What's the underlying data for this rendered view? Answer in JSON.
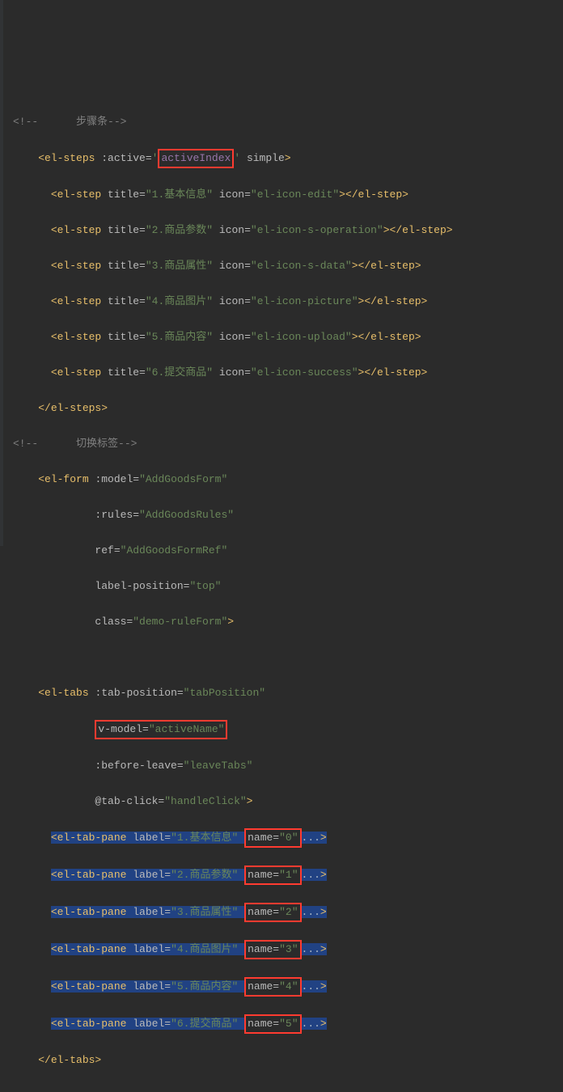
{
  "comment_steps": "步骤条",
  "comment_tabs": "切换标签",
  "steps": {
    "open": "<el-steps",
    "active_attr": ":active=",
    "active_q1": "'",
    "active_q2": "'",
    "active_val": "activeIndex",
    "simple": "simple",
    "close": "</el-steps>",
    "items": [
      {
        "title": "\"1.基本信息\"",
        "icon": "\"el-icon-edit\""
      },
      {
        "title": "\"2.商品参数\"",
        "icon": "\"el-icon-s-operation\""
      },
      {
        "title": "\"3.商品属性\"",
        "icon": "\"el-icon-s-data\""
      },
      {
        "title": "\"4.商品图片\"",
        "icon": "\"el-icon-picture\""
      },
      {
        "title": "\"5.商品内容\"",
        "icon": "\"el-icon-upload\""
      },
      {
        "title": "\"6.提交商品\"",
        "icon": "\"el-icon-success\""
      }
    ],
    "step_open": "<el-step",
    "step_close": "</el-step>",
    "title_attr": "title=",
    "icon_attr": "icon="
  },
  "form": {
    "open": "<el-form",
    "model_attr": ":model=",
    "model_val": "\"AddGoodsForm\"",
    "rules_attr": ":rules=",
    "rules_val": "\"AddGoodsRules\"",
    "ref_attr": "ref=",
    "ref_val": "\"AddGoodsFormRef\"",
    "lp_attr": "label-position=",
    "lp_val": "\"top\"",
    "class_attr": "class=",
    "class_val": "\"demo-ruleForm\""
  },
  "tabs": {
    "open": "<el-tabs",
    "close": "</el-tabs>",
    "tp_attr": ":tab-position=",
    "tp_val": "\"tabPosition\"",
    "vm_attr": "v-model=",
    "vm_val": "\"activeName\"",
    "bl_attr": ":before-leave=",
    "bl_val": "\"leaveTabs\"",
    "tc_attr": "@tab-click=",
    "tc_val": "\"handleClick\"",
    "pane_open": "<el-tab-pane",
    "label_attr": "label=",
    "name_attr": "name=",
    "panes": [
      {
        "label": "\"1.基本信息\"",
        "name": "\"0\""
      },
      {
        "label": "\"2.商品参数\"",
        "name": "\"1\""
      },
      {
        "label": "\"3.商品属性\"",
        "name": "\"2\""
      },
      {
        "label": "\"4.商品图片\"",
        "name": "\"3\""
      },
      {
        "label": "\"5.商品内容\"",
        "name": "\"4\""
      },
      {
        "label": "\"6.提交商品\"",
        "name": "\"5\""
      }
    ],
    "dots": "..."
  },
  "comment_open": "<!--",
  "comment_close": "-->"
}
